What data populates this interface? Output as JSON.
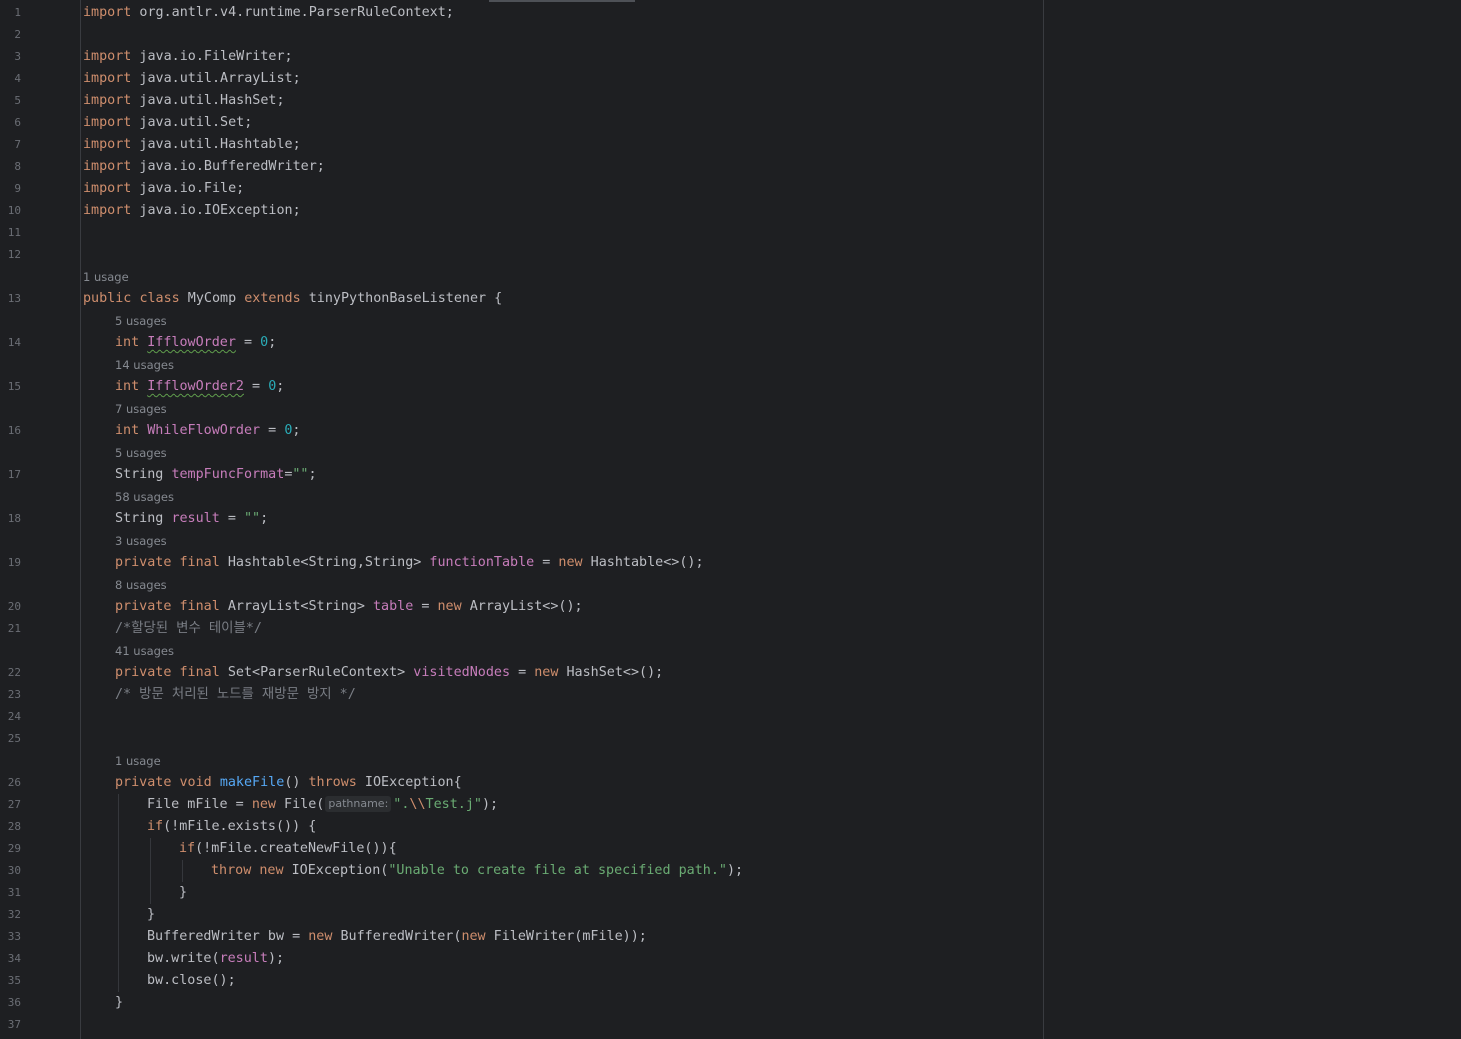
{
  "rows": [
    {
      "type": "code",
      "ln": "1",
      "indent": 0,
      "tokens": [
        [
          "kw",
          "import"
        ],
        [
          "p",
          " org.antlr.v4.runtime.ParserRuleContext;"
        ]
      ]
    },
    {
      "type": "code",
      "ln": "2",
      "indent": 0,
      "tokens": []
    },
    {
      "type": "code",
      "ln": "3",
      "indent": 0,
      "tokens": [
        [
          "kw",
          "import"
        ],
        [
          "p",
          " java.io.FileWriter;"
        ]
      ]
    },
    {
      "type": "code",
      "ln": "4",
      "indent": 0,
      "tokens": [
        [
          "kw",
          "import"
        ],
        [
          "p",
          " java.util.ArrayList;"
        ]
      ]
    },
    {
      "type": "code",
      "ln": "5",
      "indent": 0,
      "tokens": [
        [
          "kw",
          "import"
        ],
        [
          "p",
          " java.util.HashSet;"
        ]
      ]
    },
    {
      "type": "code",
      "ln": "6",
      "indent": 0,
      "tokens": [
        [
          "kw",
          "import"
        ],
        [
          "p",
          " java.util.Set;"
        ]
      ]
    },
    {
      "type": "code",
      "ln": "7",
      "indent": 0,
      "tokens": [
        [
          "kw",
          "import"
        ],
        [
          "p",
          " java.util.Hashtable;"
        ]
      ]
    },
    {
      "type": "code",
      "ln": "8",
      "indent": 0,
      "tokens": [
        [
          "kw",
          "import"
        ],
        [
          "p",
          " java.io.BufferedWriter;"
        ]
      ]
    },
    {
      "type": "code",
      "ln": "9",
      "indent": 0,
      "tokens": [
        [
          "kw",
          "import"
        ],
        [
          "p",
          " java.io.File;"
        ]
      ]
    },
    {
      "type": "code",
      "ln": "10",
      "indent": 0,
      "tokens": [
        [
          "kw",
          "import"
        ],
        [
          "p",
          " java.io.IOException;"
        ]
      ]
    },
    {
      "type": "code",
      "ln": "11",
      "indent": 0,
      "tokens": []
    },
    {
      "type": "code",
      "ln": "12",
      "indent": 0,
      "tokens": []
    },
    {
      "type": "hint",
      "indent": 0,
      "text": "1 usage"
    },
    {
      "type": "code",
      "ln": "13",
      "indent": 0,
      "tokens": [
        [
          "kw",
          "public"
        ],
        [
          "p",
          " "
        ],
        [
          "kw",
          "class"
        ],
        [
          "p",
          " MyComp "
        ],
        [
          "kw",
          "extends"
        ],
        [
          "p",
          " tinyPythonBaseListener {"
        ]
      ]
    },
    {
      "type": "hint",
      "indent": 1,
      "text": "5 usages"
    },
    {
      "type": "code",
      "ln": "14",
      "indent": 1,
      "tokens": [
        [
          "kw",
          "int"
        ],
        [
          "p",
          " "
        ],
        [
          "fldtypo",
          "IfflowOrder"
        ],
        [
          "p",
          " = "
        ],
        [
          "num",
          "0"
        ],
        [
          "p",
          ";"
        ]
      ]
    },
    {
      "type": "hint",
      "indent": 1,
      "text": "14 usages"
    },
    {
      "type": "code",
      "ln": "15",
      "indent": 1,
      "tokens": [
        [
          "kw",
          "int"
        ],
        [
          "p",
          " "
        ],
        [
          "fldtypo",
          "IfflowOrder2"
        ],
        [
          "p",
          " = "
        ],
        [
          "num",
          "0"
        ],
        [
          "p",
          ";"
        ]
      ]
    },
    {
      "type": "hint",
      "indent": 1,
      "text": "7 usages"
    },
    {
      "type": "code",
      "ln": "16",
      "indent": 1,
      "tokens": [
        [
          "kw",
          "int"
        ],
        [
          "p",
          " "
        ],
        [
          "fld",
          "WhileFlowOrder"
        ],
        [
          "p",
          " = "
        ],
        [
          "num",
          "0"
        ],
        [
          "p",
          ";"
        ]
      ]
    },
    {
      "type": "hint",
      "indent": 1,
      "text": "5 usages"
    },
    {
      "type": "code",
      "ln": "17",
      "indent": 1,
      "tokens": [
        [
          "p",
          "String "
        ],
        [
          "fld",
          "tempFuncFormat"
        ],
        [
          "p",
          "="
        ],
        [
          "str",
          "\"\""
        ],
        [
          "p",
          ";"
        ]
      ]
    },
    {
      "type": "hint",
      "indent": 1,
      "text": "58 usages"
    },
    {
      "type": "code",
      "ln": "18",
      "indent": 1,
      "tokens": [
        [
          "p",
          "String "
        ],
        [
          "fld",
          "result"
        ],
        [
          "p",
          " = "
        ],
        [
          "str",
          "\"\""
        ],
        [
          "p",
          ";"
        ]
      ]
    },
    {
      "type": "hint",
      "indent": 1,
      "text": "3 usages"
    },
    {
      "type": "code",
      "ln": "19",
      "indent": 1,
      "tokens": [
        [
          "kw",
          "private"
        ],
        [
          "p",
          " "
        ],
        [
          "kw",
          "final"
        ],
        [
          "p",
          " Hashtable<String,String> "
        ],
        [
          "fld",
          "functionTable"
        ],
        [
          "p",
          " = "
        ],
        [
          "kw",
          "new"
        ],
        [
          "p",
          " Hashtable<>();"
        ]
      ]
    },
    {
      "type": "hint",
      "indent": 1,
      "text": "8 usages"
    },
    {
      "type": "code",
      "ln": "20",
      "indent": 1,
      "tokens": [
        [
          "kw",
          "private"
        ],
        [
          "p",
          " "
        ],
        [
          "kw",
          "final"
        ],
        [
          "p",
          " ArrayList<String> "
        ],
        [
          "fld",
          "table"
        ],
        [
          "p",
          " = "
        ],
        [
          "kw",
          "new"
        ],
        [
          "p",
          " ArrayList<>();"
        ]
      ]
    },
    {
      "type": "code",
      "ln": "21",
      "indent": 1,
      "tokens": [
        [
          "cmt",
          "/*할당된 변수 테이블*/"
        ]
      ]
    },
    {
      "type": "hint",
      "indent": 1,
      "text": "41 usages"
    },
    {
      "type": "code",
      "ln": "22",
      "indent": 1,
      "tokens": [
        [
          "kw",
          "private"
        ],
        [
          "p",
          " "
        ],
        [
          "kw",
          "final"
        ],
        [
          "p",
          " Set<ParserRuleContext> "
        ],
        [
          "fld",
          "visitedNodes"
        ],
        [
          "p",
          " = "
        ],
        [
          "kw",
          "new"
        ],
        [
          "p",
          " HashSet<>();"
        ]
      ]
    },
    {
      "type": "code",
      "ln": "23",
      "indent": 1,
      "tokens": [
        [
          "cmt",
          "/* 방문 처리된 노드를 재방문 방지 */"
        ]
      ]
    },
    {
      "type": "code",
      "ln": "24",
      "indent": 0,
      "tokens": []
    },
    {
      "type": "code",
      "ln": "25",
      "indent": 0,
      "tokens": []
    },
    {
      "type": "hint",
      "indent": 1,
      "text": "1 usage"
    },
    {
      "type": "code",
      "ln": "26",
      "indent": 1,
      "tokens": [
        [
          "kw",
          "private"
        ],
        [
          "p",
          " "
        ],
        [
          "kw",
          "void"
        ],
        [
          "p",
          " "
        ],
        [
          "fn",
          "makeFile"
        ],
        [
          "p",
          "() "
        ],
        [
          "kw",
          "throws"
        ],
        [
          "p",
          " IOException{"
        ]
      ]
    },
    {
      "type": "code",
      "ln": "27",
      "indent": 2,
      "tokens": [
        [
          "p",
          "File mFile = "
        ],
        [
          "kw",
          "new"
        ],
        [
          "p",
          " File("
        ],
        [
          "inlay",
          "pathname:"
        ],
        [
          "str",
          "\"."
        ],
        [
          "esc",
          "\\\\"
        ],
        [
          "str",
          "Test.j\""
        ],
        [
          "p",
          ");"
        ]
      ]
    },
    {
      "type": "code",
      "ln": "28",
      "indent": 2,
      "tokens": [
        [
          "kw",
          "if"
        ],
        [
          "p",
          "(!mFile.exists()) {"
        ]
      ]
    },
    {
      "type": "code",
      "ln": "29",
      "indent": 3,
      "tokens": [
        [
          "kw",
          "if"
        ],
        [
          "p",
          "(!mFile.createNewFile()){"
        ]
      ]
    },
    {
      "type": "code",
      "ln": "30",
      "indent": 4,
      "tokens": [
        [
          "kw",
          "throw"
        ],
        [
          "p",
          " "
        ],
        [
          "kw",
          "new"
        ],
        [
          "p",
          " IOException("
        ],
        [
          "str",
          "\"Unable to create file at specified path.\""
        ],
        [
          "p",
          ");"
        ]
      ]
    },
    {
      "type": "code",
      "ln": "31",
      "indent": 3,
      "tokens": [
        [
          "p",
          "}"
        ]
      ]
    },
    {
      "type": "code",
      "ln": "32",
      "indent": 2,
      "tokens": [
        [
          "p",
          "}"
        ]
      ]
    },
    {
      "type": "code",
      "ln": "33",
      "indent": 2,
      "tokens": [
        [
          "p",
          "BufferedWriter bw = "
        ],
        [
          "kw",
          "new"
        ],
        [
          "p",
          " BufferedWriter("
        ],
        [
          "kw",
          "new"
        ],
        [
          "p",
          " FileWriter(mFile));"
        ]
      ]
    },
    {
      "type": "code",
      "ln": "34",
      "indent": 2,
      "tokens": [
        [
          "p",
          "bw.write("
        ],
        [
          "fld",
          "result"
        ],
        [
          "p",
          ");"
        ]
      ]
    },
    {
      "type": "code",
      "ln": "35",
      "indent": 2,
      "tokens": [
        [
          "p",
          "bw.close();"
        ]
      ]
    },
    {
      "type": "code",
      "ln": "36",
      "indent": 1,
      "tokens": [
        [
          "p",
          "}"
        ]
      ]
    },
    {
      "type": "code",
      "ln": "37",
      "indent": 0,
      "tokens": []
    }
  ]
}
